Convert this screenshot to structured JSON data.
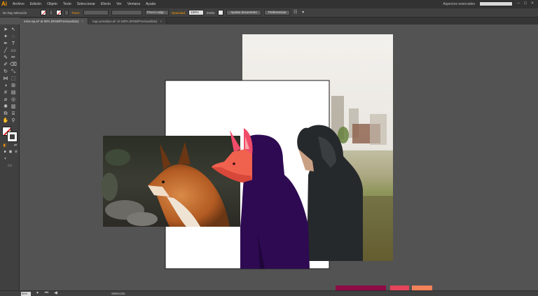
{
  "app": {
    "logo": "Ai"
  },
  "menu": [
    "Archivo",
    "Edición",
    "Objeto",
    "Texto",
    "Seleccionar",
    "Efecto",
    "Ver",
    "Ventana",
    "Ayuda"
  ],
  "workspace": {
    "label": "Aspectos esenciales",
    "search_placeholder": ""
  },
  "window_controls": {
    "minimize": "–",
    "maximize": "□",
    "close": "×"
  },
  "control_bar": {
    "selection_label": "No hay selección",
    "stroke_label": "Trazo:",
    "brush_value": "Pincel caligr...",
    "opacity_label": "Opacidad:",
    "opacity_value": "100%",
    "style_label": "Estilo:",
    "doc_setup_button": "Ajustar documento",
    "preferences_button": "Preferencias"
  },
  "tabs": [
    {
      "label": "mms np.ai* al 50% (RGB/Previsualizar)",
      "close": "×",
      "active": true
    },
    {
      "label": "logo prototipo.ai* al 150% (RGB/Previsualizar)",
      "close": "×",
      "active": false
    }
  ],
  "status": {
    "zoom": "50%",
    "tool": "Selección"
  },
  "tools": [
    "selection-tool",
    "direct-selection-tool",
    "magic-wand-tool",
    "lasso-tool",
    "pen-tool",
    "type-tool",
    "line-tool",
    "rectangle-tool",
    "paintbrush-tool",
    "pencil-tool",
    "blob-brush-tool",
    "eraser-tool",
    "rotate-tool",
    "scale-tool",
    "width-tool",
    "free-transform-tool",
    "shape-builder-tool",
    "perspective-grid-tool",
    "mesh-tool",
    "gradient-tool",
    "eyedropper-tool",
    "blend-tool",
    "symbol-sprayer-tool",
    "column-graph-tool",
    "artboard-tool",
    "slice-tool",
    "hand-tool",
    "zoom-tool"
  ],
  "colors": {
    "accent": "#ff9a00",
    "fill": "#ffffff",
    "hood": "#2e0a52",
    "fox_mask": "#f0614e",
    "fox_ear": "#f04c69",
    "palette": [
      "#8e0b46",
      "#e5455a",
      "#f2825a"
    ]
  }
}
